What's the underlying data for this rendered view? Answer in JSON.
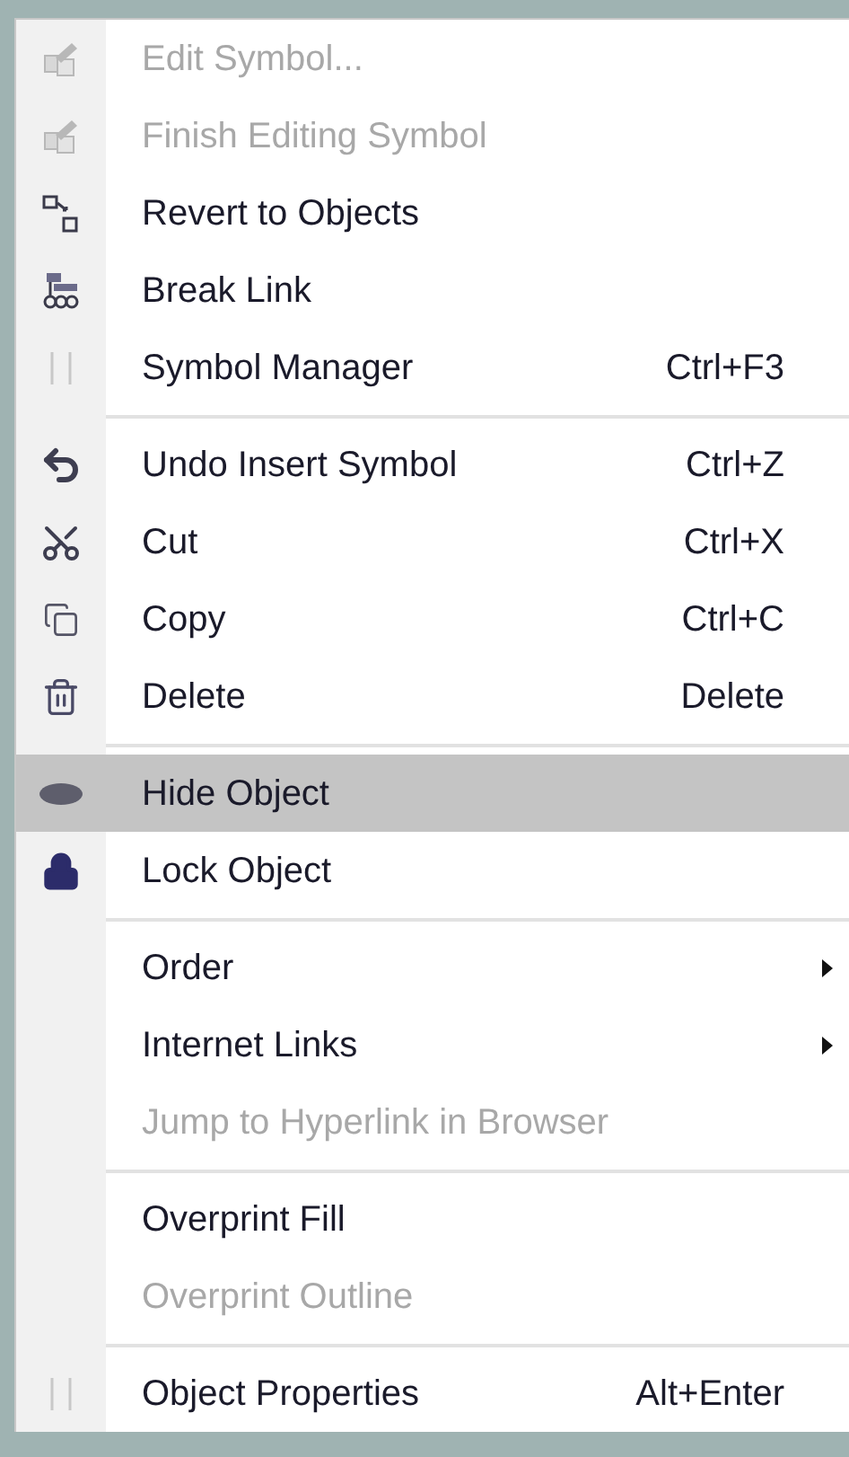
{
  "context_menu": {
    "items": [
      {
        "kind": "item",
        "label": "Edit Symbol...",
        "disabled": true,
        "selected": false
      },
      {
        "kind": "item",
        "label": "Finish Editing Symbol",
        "disabled": true,
        "selected": false
      },
      {
        "kind": "item",
        "label": "Revert to Objects",
        "disabled": false,
        "selected": false
      },
      {
        "kind": "item",
        "label": "Break Link",
        "disabled": false,
        "selected": false
      },
      {
        "kind": "item",
        "label": "Symbol Manager",
        "shortcut": "Ctrl+F3",
        "disabled": false,
        "selected": false
      },
      {
        "kind": "separator"
      },
      {
        "kind": "item",
        "label": "Undo Insert Symbol",
        "shortcut": "Ctrl+Z",
        "disabled": false,
        "selected": false
      },
      {
        "kind": "item",
        "label": "Cut",
        "shortcut": "Ctrl+X",
        "disabled": false,
        "selected": false
      },
      {
        "kind": "item",
        "label": "Copy",
        "shortcut": "Ctrl+C",
        "disabled": false,
        "selected": false
      },
      {
        "kind": "item",
        "label": "Delete",
        "shortcut": "Delete",
        "disabled": false,
        "selected": false
      },
      {
        "kind": "separator"
      },
      {
        "kind": "item",
        "label": "Hide Object",
        "disabled": false,
        "selected": true
      },
      {
        "kind": "item",
        "label": "Lock Object",
        "disabled": false,
        "selected": false
      },
      {
        "kind": "separator"
      },
      {
        "kind": "item",
        "label": "Order",
        "submenu": true,
        "disabled": false,
        "selected": false
      },
      {
        "kind": "item",
        "label": "Internet Links",
        "submenu": true,
        "disabled": false,
        "selected": false
      },
      {
        "kind": "item",
        "label": "Jump to Hyperlink in Browser",
        "disabled": true,
        "selected": false
      },
      {
        "kind": "separator"
      },
      {
        "kind": "item",
        "label": "Overprint Fill",
        "disabled": false,
        "selected": false
      },
      {
        "kind": "item",
        "label": "Overprint Outline",
        "disabled": true,
        "selected": false
      },
      {
        "kind": "separator"
      },
      {
        "kind": "item",
        "label": "Object Properties",
        "shortcut": "Alt+Enter",
        "disabled": false,
        "selected": false
      }
    ]
  }
}
